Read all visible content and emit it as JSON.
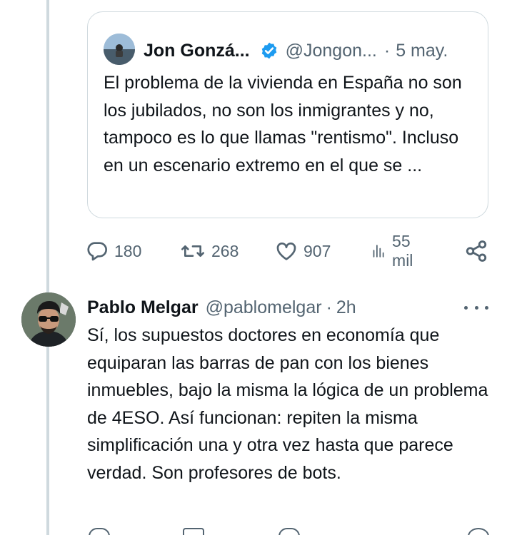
{
  "quoted_tweet": {
    "author_name": "Jon Gonzá...",
    "handle": "@Jongon...",
    "separator": "·",
    "date": "5 may.",
    "text": "El problema de la vivienda en España no son los jubilados, no son los inmigrantes y no, tampoco es lo que llamas \"rentismo\". Incluso en un escenario extremo en el que se ..."
  },
  "actions": {
    "replies": "180",
    "reposts": "268",
    "likes": "907",
    "views": "55 mil"
  },
  "reply_tweet": {
    "author_name": "Pablo Melgar",
    "handle": "@pablomelgar",
    "separator": "·",
    "time": "2h",
    "text": "Sí, los supuestos doctores en economía que equiparan las barras de pan con los bienes inmuebles, bajo la misma la lógica de un problema de 4ESO. Así funcionan: repiten la misma simplificación una y otra vez hasta que parece verdad. Son profesores de bots."
  },
  "colors": {
    "text_primary": "#0f1419",
    "text_secondary": "#536471",
    "border": "#cfd9de",
    "verified_blue": "#1d9bf0"
  },
  "icons": [
    "reply-icon",
    "repost-icon",
    "like-icon",
    "views-icon",
    "share-icon",
    "verified-badge-icon",
    "more-icon"
  ]
}
